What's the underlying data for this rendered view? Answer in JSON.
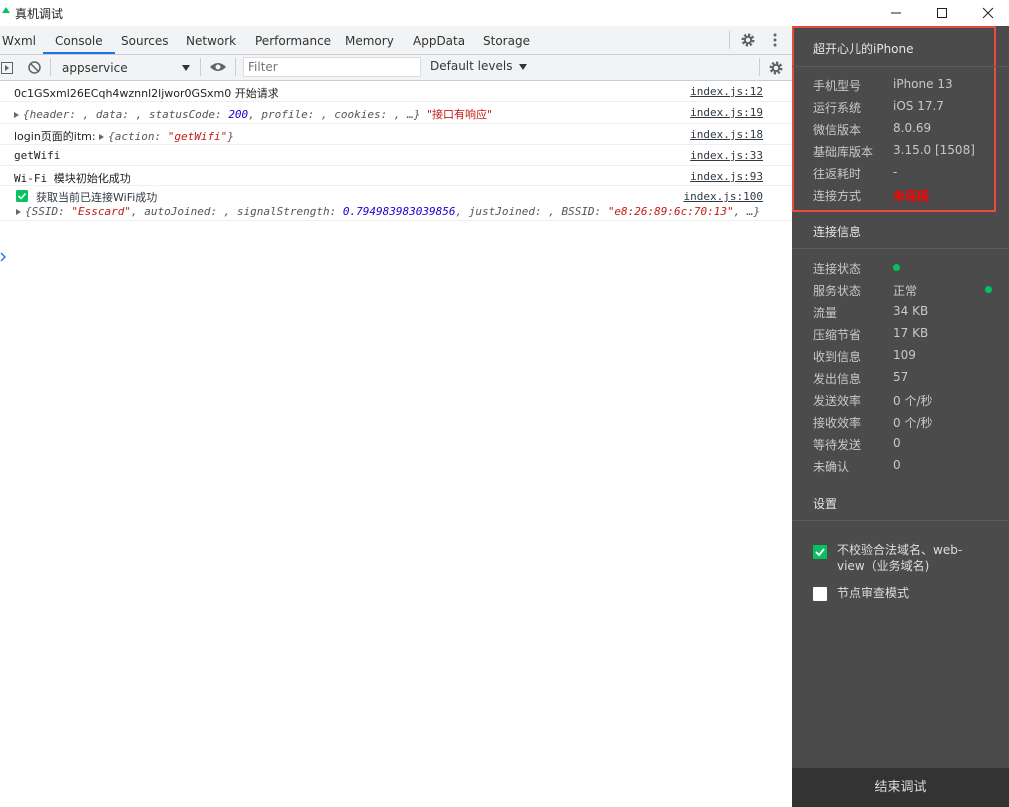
{
  "window": {
    "title": "真机调试"
  },
  "tabs": [
    "Wxml",
    "Console",
    "Sources",
    "Network",
    "Performance",
    "Memory",
    "AppData",
    "Storage"
  ],
  "active_tab": "Console",
  "toolbar": {
    "context": "appservice",
    "filter_placeholder": "Filter",
    "levels": "Default levels"
  },
  "console": {
    "rows": [
      {
        "msg": "0c1GSxml26ECqh4wznnl2ljwor0GSxm0 开始请求",
        "src": "index.js:12"
      },
      {
        "pre": "{header: , data: , statusCode: ",
        "num": "200",
        "post": ", profile: , cookies: , …}",
        "str": "\"接口有响应\"",
        "src": "index.js:19"
      },
      {
        "pre": "login页面的itm: ",
        "obj_pre": "{action: ",
        "obj_str": "\"getWifi\"",
        "obj_post": "}",
        "src": "index.js:18"
      },
      {
        "msg": "getWifi",
        "src": "index.js:33"
      },
      {
        "msg": "Wi-Fi 模块初始化成功",
        "src": "index.js:93"
      },
      {
        "msg": "获取当前已连接WiFi成功",
        "src": "index.js:100",
        "detail_pre": "{SSID: ",
        "ssid": "\"Esscard\"",
        "detail_mid": ", autoJoined: , signalStrength: ",
        "signal": "0.794983983039856",
        "detail_mid2": ", justJoined: , BSSID: ",
        "bssid": "\"e8:26:89:6c:70:13\"",
        "detail_post": ", …}"
      }
    ]
  },
  "panel": {
    "device_name": "超开心儿的iPhone",
    "device_info": [
      {
        "k": "手机型号",
        "v": "iPhone 13"
      },
      {
        "k": "运行系统",
        "v": "iOS 17.7"
      },
      {
        "k": "微信版本",
        "v": "8.0.69"
      },
      {
        "k": "基础库版本",
        "v": "3.15.0 [1508]"
      },
      {
        "k": "往返耗时",
        "v": "-"
      },
      {
        "k": "连接方式",
        "v": "未连接"
      }
    ],
    "conn_title": "连接信息",
    "conn_info": [
      {
        "k": "连接状态",
        "v": ""
      },
      {
        "k": "服务状态",
        "v": "正常"
      },
      {
        "k": "流量",
        "v": "34 KB"
      },
      {
        "k": "压缩节省",
        "v": "17 KB"
      },
      {
        "k": "收到信息",
        "v": "109"
      },
      {
        "k": "发出信息",
        "v": "57"
      },
      {
        "k": "发送效率",
        "v": "0 个/秒"
      },
      {
        "k": "接收效率",
        "v": "0 个/秒"
      },
      {
        "k": "等待发送",
        "v": "0"
      },
      {
        "k": "未确认",
        "v": "0"
      }
    ],
    "settings_title": "设置",
    "settings": [
      {
        "label": "不校验合法域名、web-view（业务域名)",
        "checked": true
      },
      {
        "label": "节点审查模式",
        "checked": false
      }
    ],
    "end_button": "结束调试"
  },
  "colors": {
    "accent": "#1a73e8",
    "panel_bg": "#4b4b4b",
    "ok": "#07c160",
    "warn": "#e74c3c"
  }
}
